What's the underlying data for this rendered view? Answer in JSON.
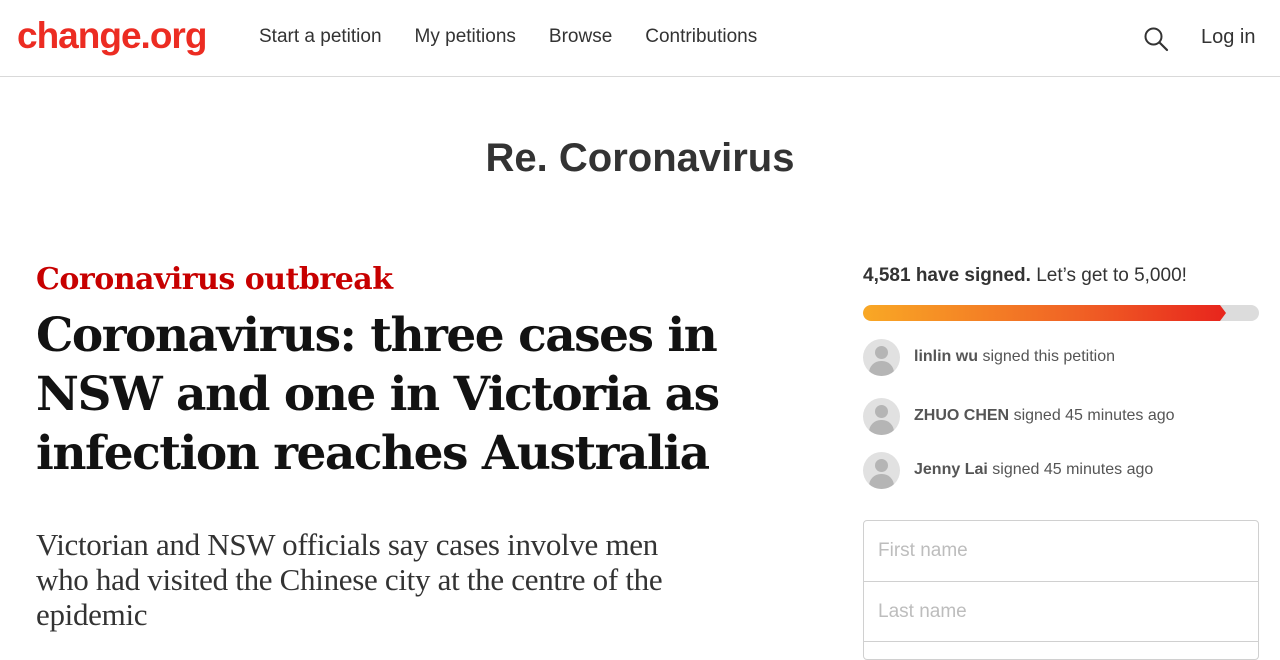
{
  "header": {
    "logo": "change.org",
    "nav": [
      "Start a petition",
      "My petitions",
      "Browse",
      "Contributions"
    ],
    "login": "Log in",
    "search_icon": "search-icon"
  },
  "petition": {
    "title": "Re. Coronavirus"
  },
  "article_image": {
    "kicker": "Coronavirus outbreak",
    "headline_lines": [
      "Coronavirus: three cases in",
      "NSW and one in Victoria as",
      "infection reaches Australia"
    ],
    "standfirst_lines": [
      "Victorian and NSW officials say cases involve men",
      "who had visited the Chinese city at the centre of the",
      "epidemic"
    ],
    "kicker_color": "#c70000"
  },
  "sidebar": {
    "signed_count": "4,581 have signed.",
    "goal_text": "Let’s get to 5,000!",
    "progress": {
      "signed": 4581,
      "goal": 5000
    },
    "signers": [
      {
        "name": "linlin wu",
        "action": "signed this petition"
      },
      {
        "name": "ZHUO CHEN",
        "action": "signed 45 minutes ago"
      },
      {
        "name": "Jenny Lai",
        "action": "signed 45 minutes ago"
      }
    ],
    "form": {
      "first_name_placeholder": "First name",
      "last_name_placeholder": "Last name"
    }
  },
  "colors": {
    "brand": "#ec2c22",
    "progress_start": "#f9a825",
    "progress_end": "#e8271d"
  }
}
